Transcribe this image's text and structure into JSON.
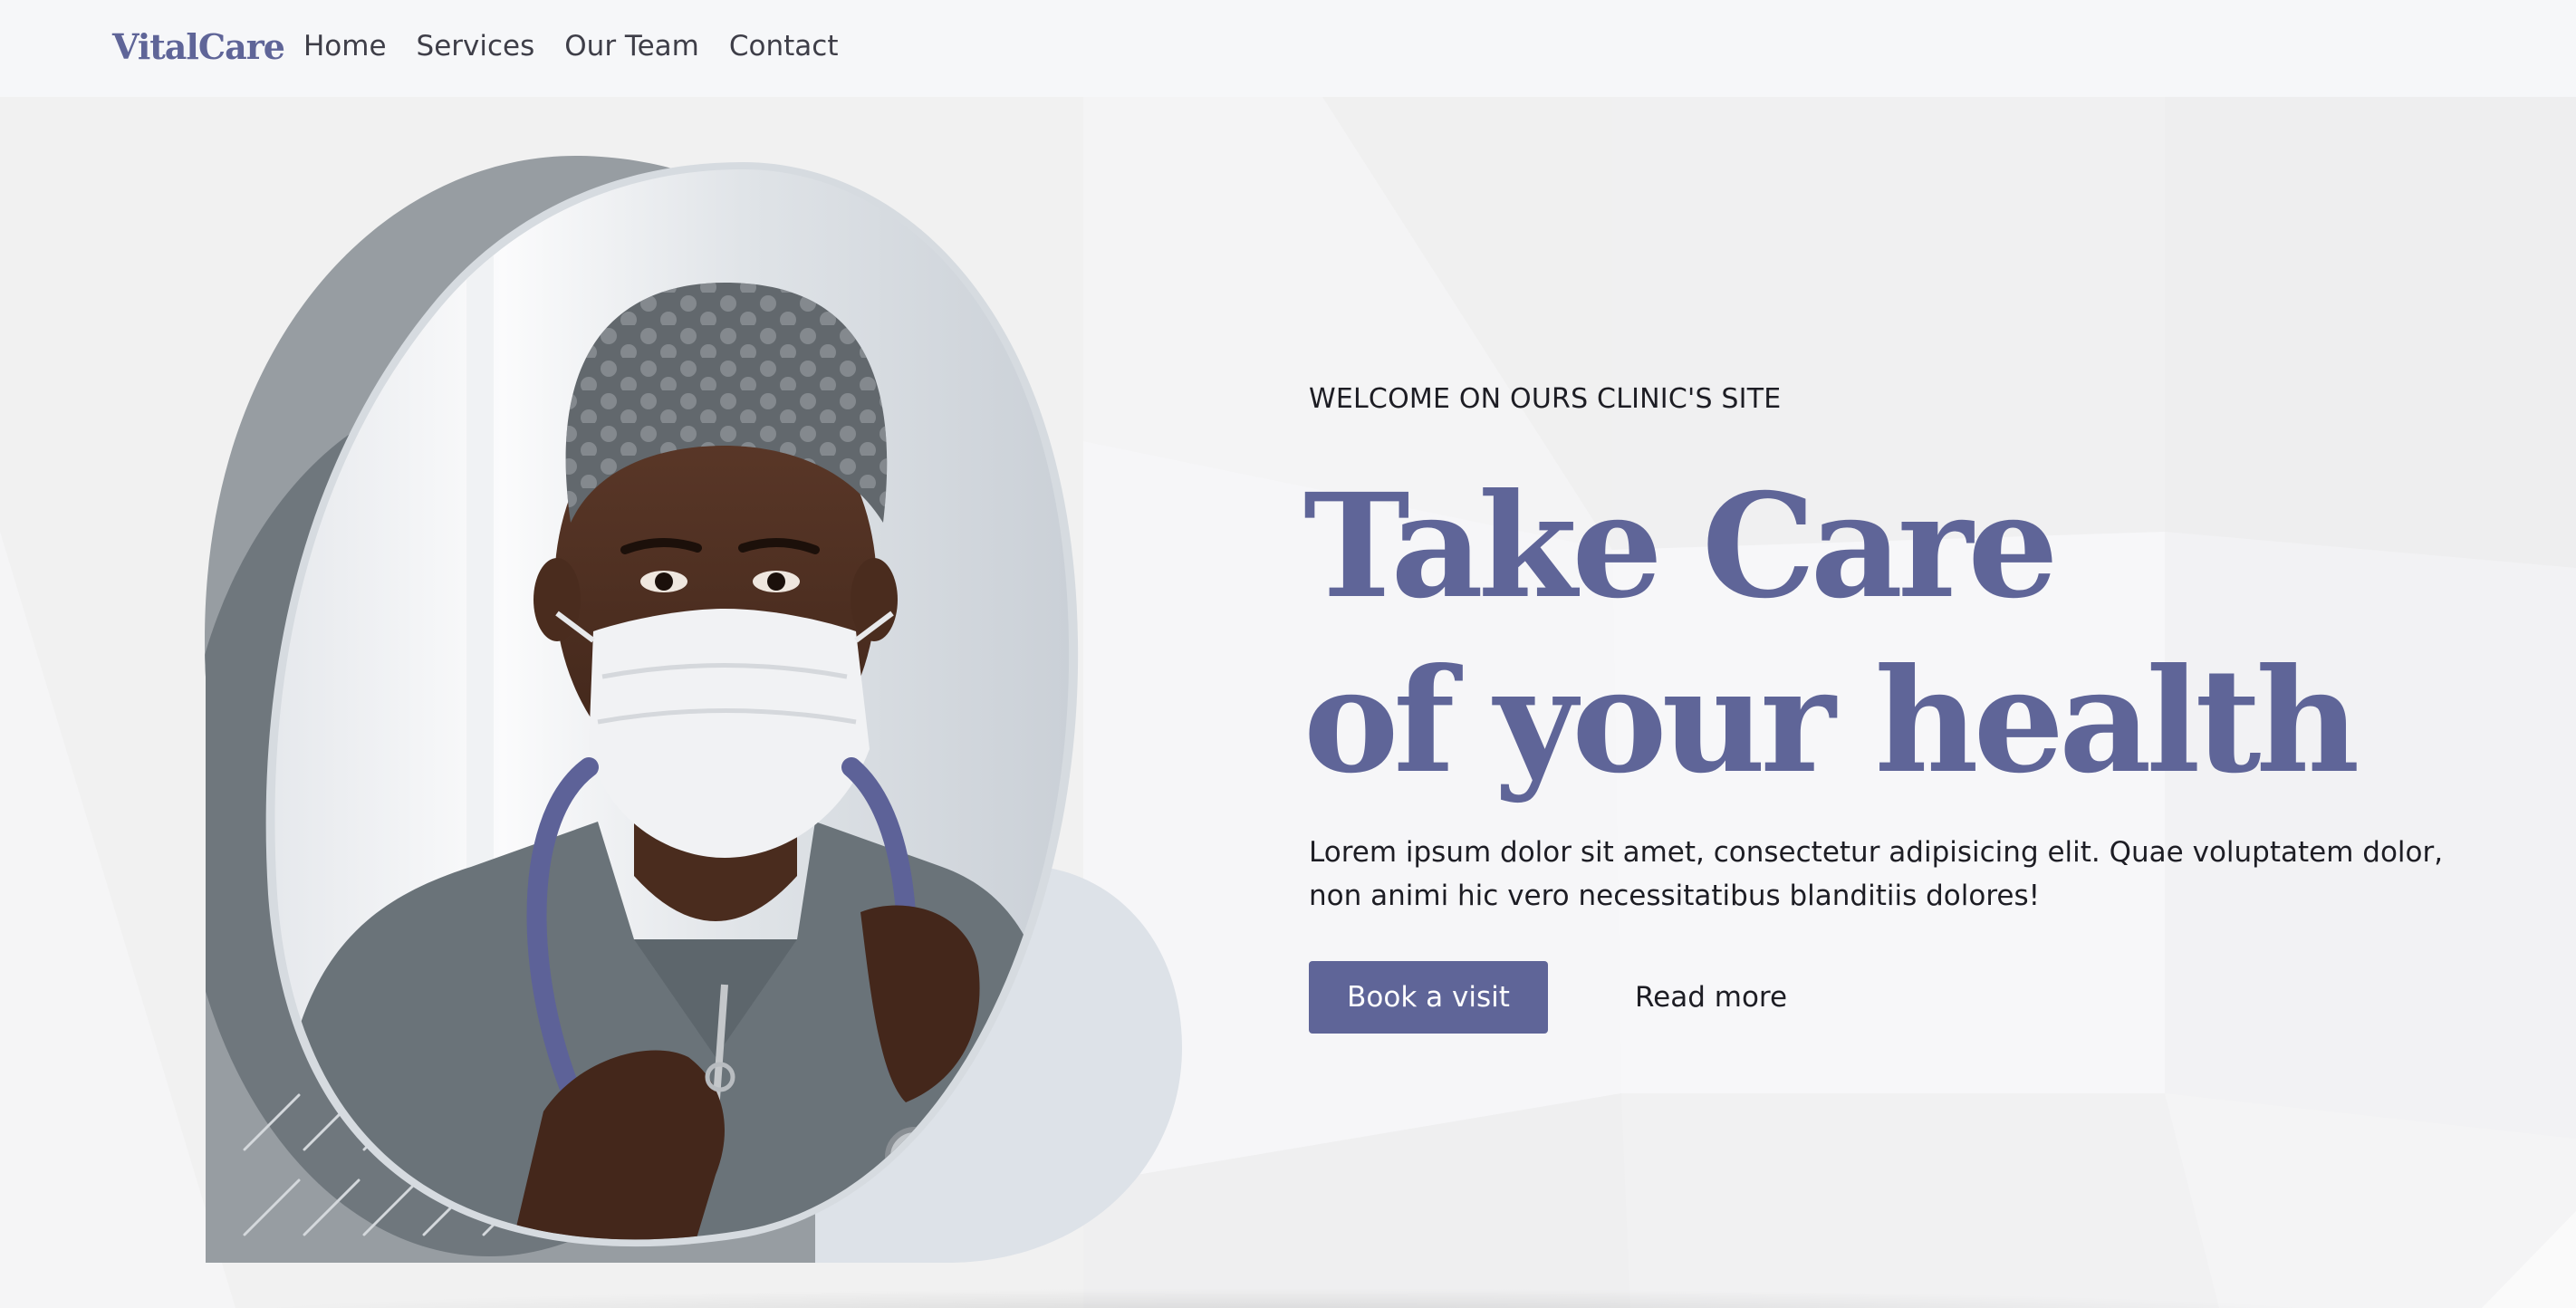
{
  "header": {
    "logo": "VitalCare",
    "nav": [
      {
        "label": "Home"
      },
      {
        "label": "Services"
      },
      {
        "label": "Our Team"
      },
      {
        "label": "Contact"
      }
    ]
  },
  "hero": {
    "eyebrow": "WELCOME ON OURS CLINIC'S SITE",
    "headline_line1": "Take Care",
    "headline_line2": "of your health",
    "description": "Lorem ipsum dolor sit amet, consectetur adipisicing elit. Quae voluptatem dolor, non animi hic vero necessitatibus blanditiis dolores!",
    "primary_button": "Book a visit",
    "secondary_link": "Read more",
    "image_subject": "doctor in surgical cap and mask with stethoscope"
  },
  "colors": {
    "brand": "#5f6598",
    "button_text": "#ffffff",
    "nav_background": "#f6f7f9",
    "page_background": "#f0f0f0",
    "shape_dark": "#979da2",
    "shape_light": "#dde2e8"
  },
  "icons": [
    "doctor-photo",
    "diagonal-lines-pattern"
  ]
}
